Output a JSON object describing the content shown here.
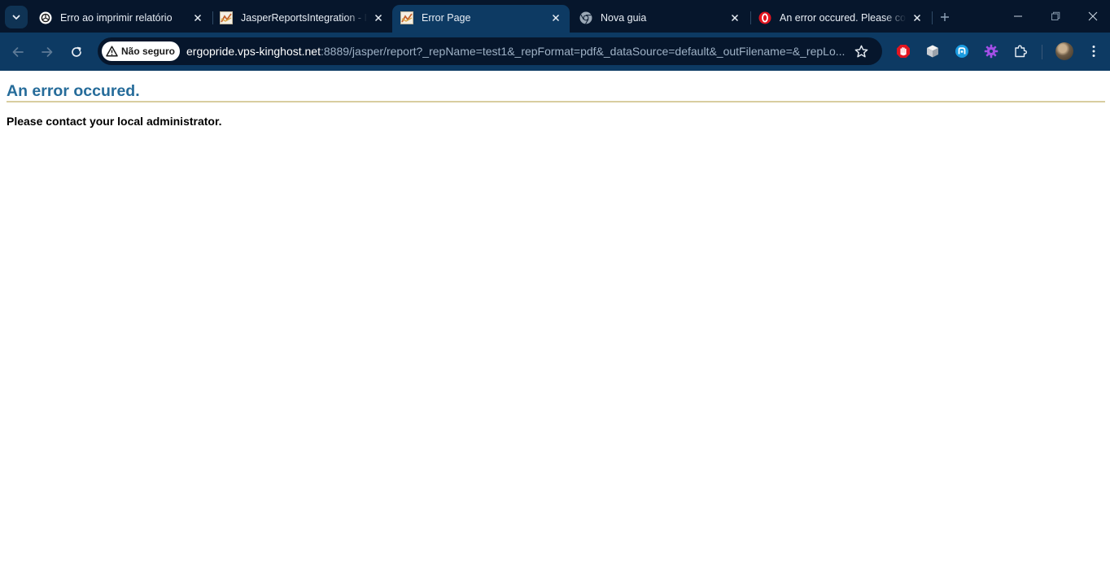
{
  "tabs": [
    {
      "title": "Erro ao imprimir relatório",
      "favicon": "openai-icon",
      "active": false
    },
    {
      "title": "JasperReportsIntegration - Ir",
      "favicon": "jasper-icon",
      "active": false
    },
    {
      "title": "Error Page",
      "favicon": "jasper-icon",
      "active": true
    },
    {
      "title": "Nova guia",
      "favicon": "chrome-icon",
      "active": false
    },
    {
      "title": "An error occured. Please con",
      "favicon": "opera-icon",
      "active": false
    }
  ],
  "toolbar": {
    "security_label": "Não seguro",
    "url_host": "ergopride.vps-kinghost.net",
    "url_rest": ":8889/jasper/report?_repName=test1&_repFormat=pdf&_dataSource=default&_outFilename=&_repLo..."
  },
  "page": {
    "title": "An error occured.",
    "message": "Please contact your local administrator."
  },
  "colors": {
    "tabstrip": "#06162c",
    "toolbar": "#0d3a63",
    "title": "#266c9a",
    "rule": "#d8cda0"
  }
}
